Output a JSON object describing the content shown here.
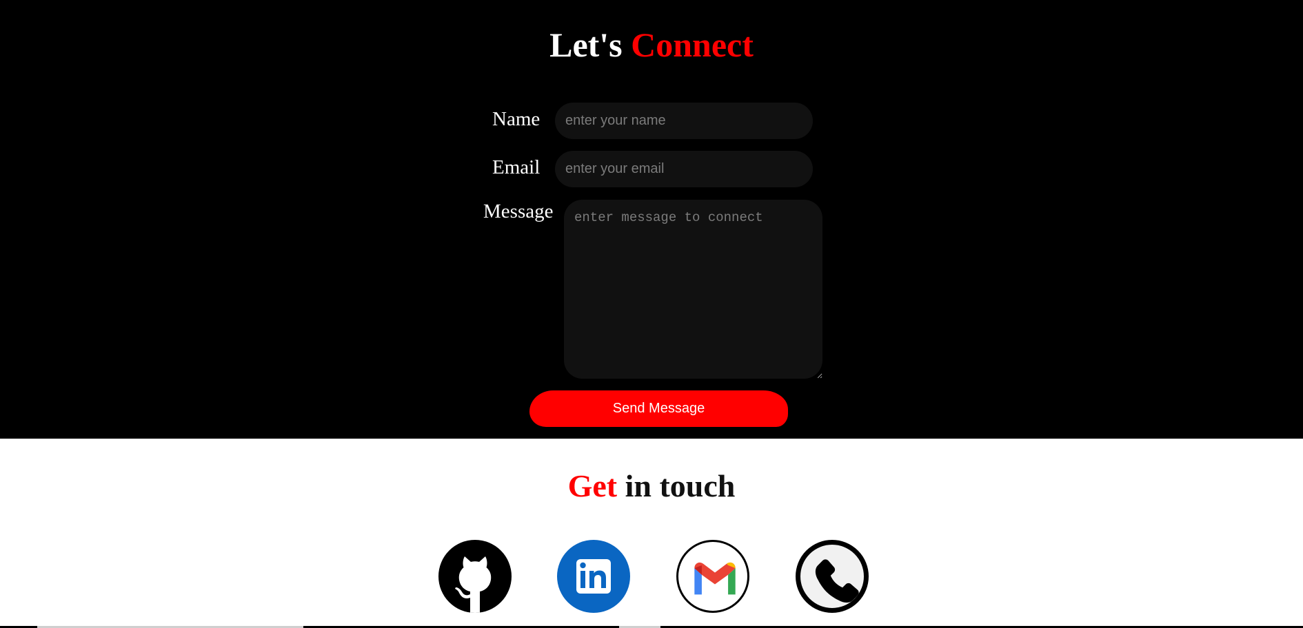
{
  "connect": {
    "title_part1": "Let's",
    "title_part2": "Connect",
    "name_label": "Name",
    "name_placeholder": "enter your name",
    "email_label": "Email",
    "email_placeholder": "enter your email",
    "message_label": "Message",
    "message_placeholder": "enter message to connect",
    "send_label": "Send Message"
  },
  "touch": {
    "title_part1": "Get",
    "title_part2": "in touch",
    "socials": [
      {
        "icon": "github-icon"
      },
      {
        "icon": "linkedin-icon",
        "text": "in"
      },
      {
        "icon": "gmail-icon"
      },
      {
        "icon": "phone-icon"
      }
    ]
  },
  "colors": {
    "accent": "#ff0000",
    "dark_bg": "#000000",
    "input_bg": "#111111",
    "linkedin": "#0a66c2"
  }
}
